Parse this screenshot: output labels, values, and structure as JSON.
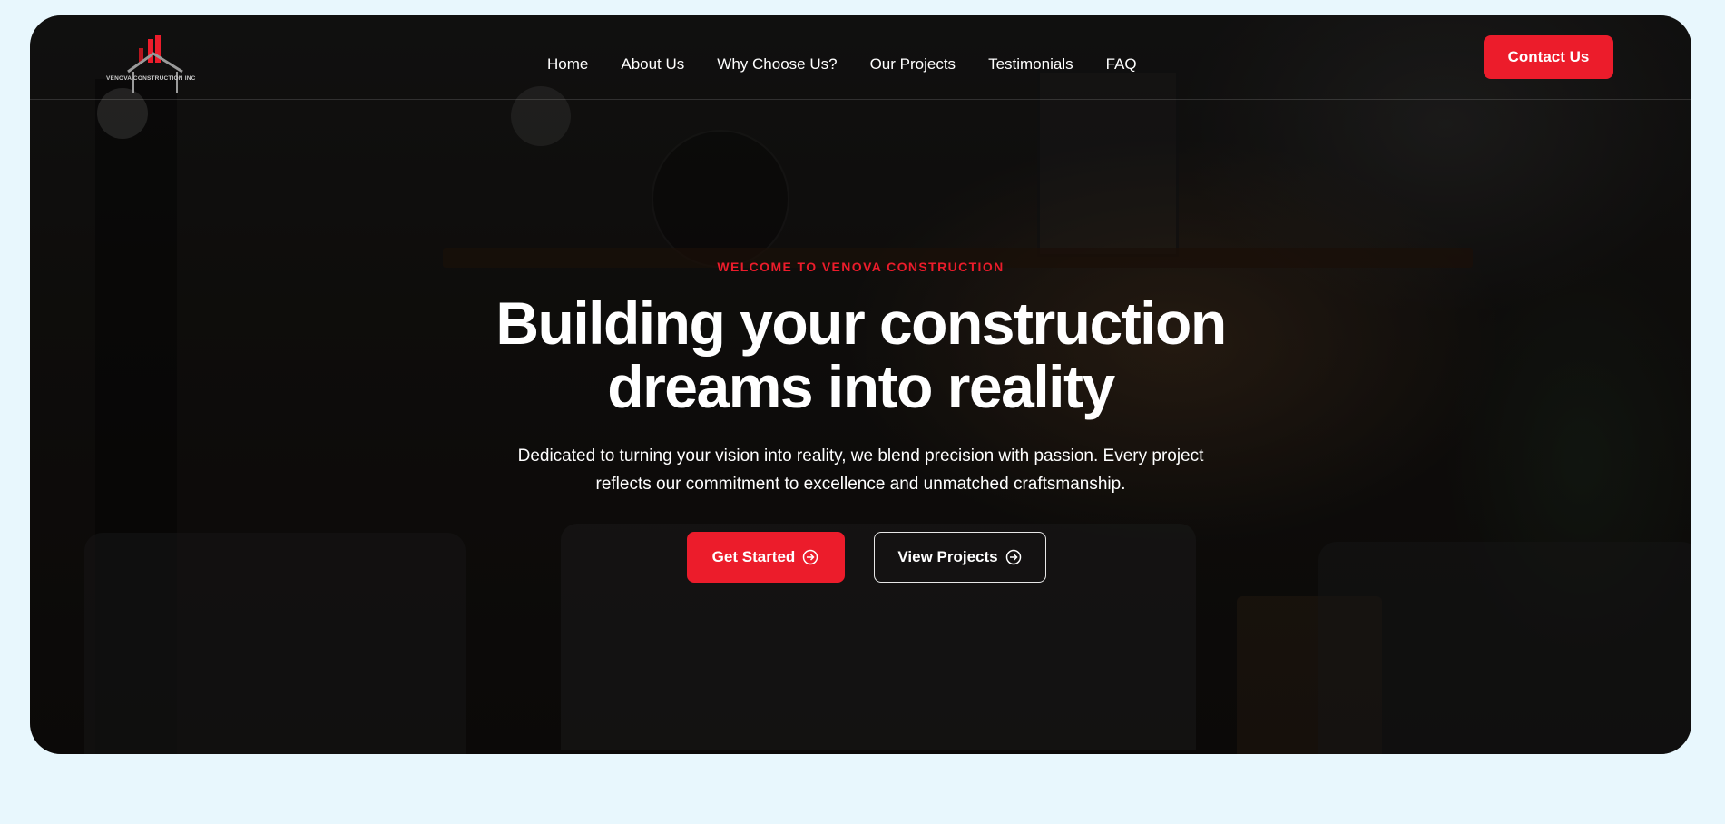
{
  "nav": {
    "logo_text": "VENOVA CONSTRUCTION INC",
    "links": [
      "Home",
      "About Us",
      "Why Choose Us?",
      "Our Projects",
      "Testimonials",
      "FAQ"
    ],
    "contact_label": "Contact Us"
  },
  "hero": {
    "eyebrow": "WELCOME TO VENOVA CONSTRUCTION",
    "headline_line1": "Building your construction",
    "headline_line2": "dreams into reality",
    "subtext_line1": "Dedicated to turning your vision into reality, we blend precision with passion. Every project",
    "subtext_line2": "reflects our commitment to excellence and unmatched craftsmanship.",
    "primary_cta": "Get Started",
    "secondary_cta": "View Projects",
    "cta_icon": "arrow-right-circle-icon"
  },
  "colors": {
    "accent": "#ec1c2b",
    "page_background": "#e8f7fd",
    "hero_overlay": "#141210"
  }
}
